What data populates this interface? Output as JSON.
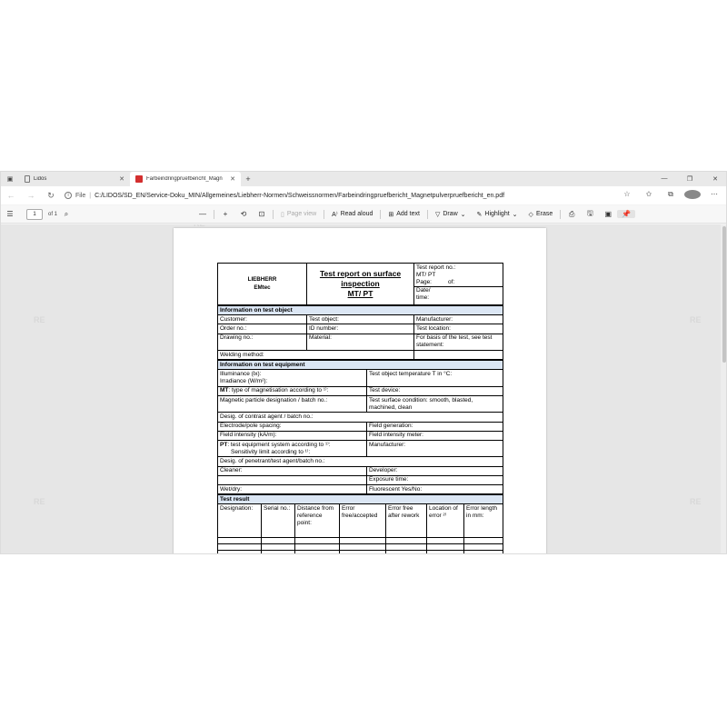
{
  "browser": {
    "tabs": [
      {
        "label": "Lidos",
        "active": false
      },
      {
        "label": "Farbeindringpruefbericht_Magn",
        "active": true
      }
    ],
    "address": {
      "scheme": "File",
      "url": "C:/LIDOS/SD_EN/Service-Doku_MIN/Allgemeines/Liebherr-Normen/Schweissnormen/Farbeindringpruefbericht_Magnetpulverpruefbericht_en.pdf"
    }
  },
  "pdf_toolbar": {
    "page_number": "1",
    "page_count": "of 1",
    "page_view": "Page view",
    "read_aloud": "Read aloud",
    "add_text": "Add text",
    "draw": "Draw",
    "highlight": "Highlight",
    "erase": "Erase"
  },
  "watermark": "RE",
  "form": {
    "logo_line1": "LIEBHERR",
    "logo_line2": "EMtec",
    "title_line1": "Test report on surface",
    "title_line2": "inspection",
    "title_line3": "MT/ PT",
    "report_no": "Test report no.:",
    "report_type": "MT/ PT",
    "page": "Page:",
    "of": "of:",
    "date_line1": "Date/",
    "date_line2": "time:",
    "sec_object": "Information on test object",
    "customer": "Customer:",
    "test_object": "Test object:",
    "manufacturer": "Manufacturer:",
    "order_no": "Order no.:",
    "id_number": "ID number:",
    "test_location": "Test location:",
    "drawing_no": "Drawing no.:",
    "material": "Material:",
    "basis_line1": "For basis of the test, see test",
    "basis_line2": "statement:",
    "welding_method": "Welding method:",
    "sec_equipment": "Information on test equipment",
    "illuminance": "Illuminance (lx):",
    "irradiance": "Irradiance (W/m²):",
    "object_temp": "Test object temperature T in °C:",
    "mt_label": "MT",
    "mt_type": ": type of magnetisation according to ¹⁾:",
    "test_device": "Test device:",
    "magnetic_particle": "Magnetic particle designation / batch no.:",
    "surface_cond_line1": "Test surface condition: smooth, blasted,",
    "surface_cond_line2": "machined, clean",
    "contrast_agent": "Desig. of contrast agent / batch no.:",
    "electrode": "Electrode/pole spacing:",
    "field_generation": "Field generation:",
    "field_intensity": "Field intensity (kA/m):",
    "field_meter": "Field intensity meter:",
    "pt_label": "PT",
    "pt_system": ": test equipment system according to ¹⁾:",
    "pt_sensitivity": "Sensitivity limit according to ¹⁾:",
    "pt_manufacturer": "Manufacturer:",
    "penetrant": "Desig. of penetrant/test agent/batch no.:",
    "cleaner": "Cleaner:",
    "developer": "Developer:",
    "exposure": "Exposure time:",
    "wet_dry": "Wet/dry:",
    "fluorescent": "Fluorescent Yes/No:",
    "sec_result": "Test result",
    "result_headers": [
      "Designation:",
      "Serial no.:",
      "Distance from reference point:",
      "Error free/accepted",
      "Error free after rework",
      "Location of error ²⁾",
      "Error length in mm:"
    ]
  },
  "colors": {
    "section_fill": "#dbe6f4",
    "viewer_bg": "#e6e6e6",
    "pdf_badge": "#d32f2f"
  }
}
